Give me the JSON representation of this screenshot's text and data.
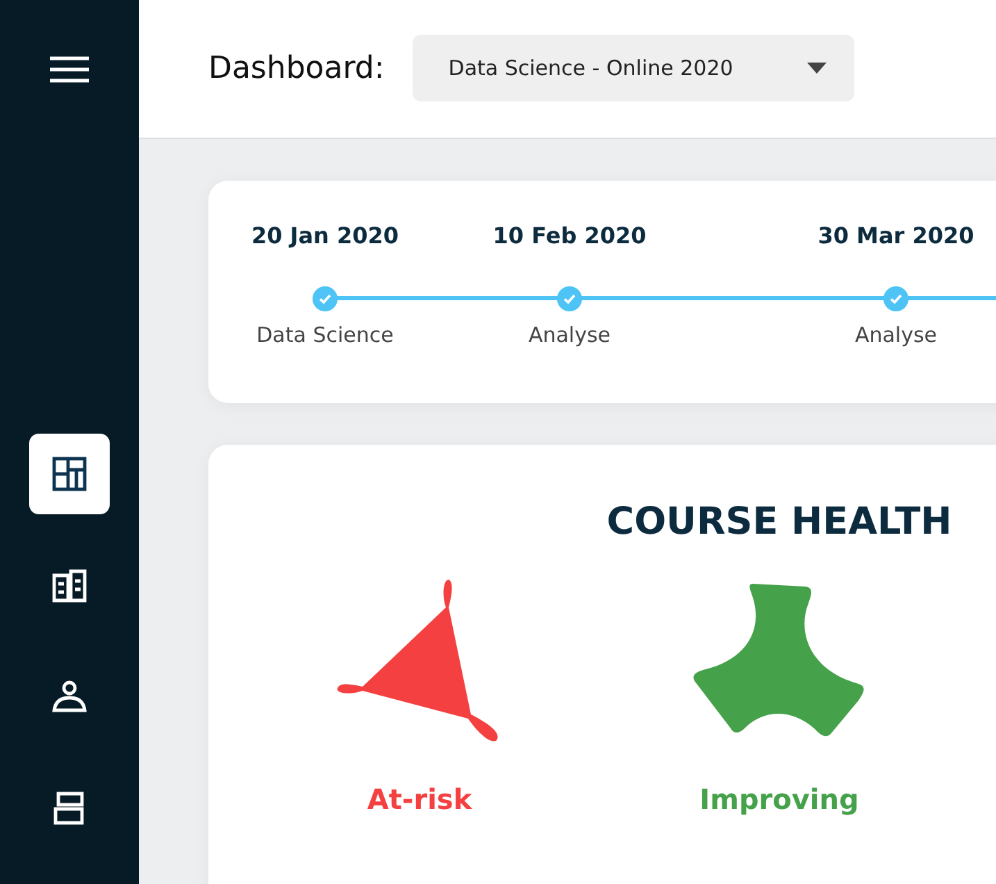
{
  "sidebar": {
    "items": [
      {
        "kind": "dashboard",
        "selected": true
      },
      {
        "kind": "library",
        "selected": false
      },
      {
        "kind": "person",
        "selected": false
      },
      {
        "kind": "layers",
        "selected": false
      }
    ]
  },
  "header": {
    "title": "Dashboard:",
    "dropdown": {
      "value": "Data Science - Online 2020"
    }
  },
  "timeline": {
    "milestones": [
      {
        "date": "20 Jan 2020",
        "label": "Data Science",
        "done": true
      },
      {
        "date": "10 Feb 2020",
        "label": "Analyse",
        "done": true
      },
      {
        "date": "30 Mar 2020",
        "label": "Analyse",
        "done": true
      }
    ]
  },
  "course_health": {
    "title": "COURSE HEALTH",
    "items": [
      {
        "kind": "at_risk",
        "label": "At-risk",
        "color": "#f44040"
      },
      {
        "kind": "improving",
        "label": "Improving",
        "color": "#45a14a"
      }
    ]
  }
}
